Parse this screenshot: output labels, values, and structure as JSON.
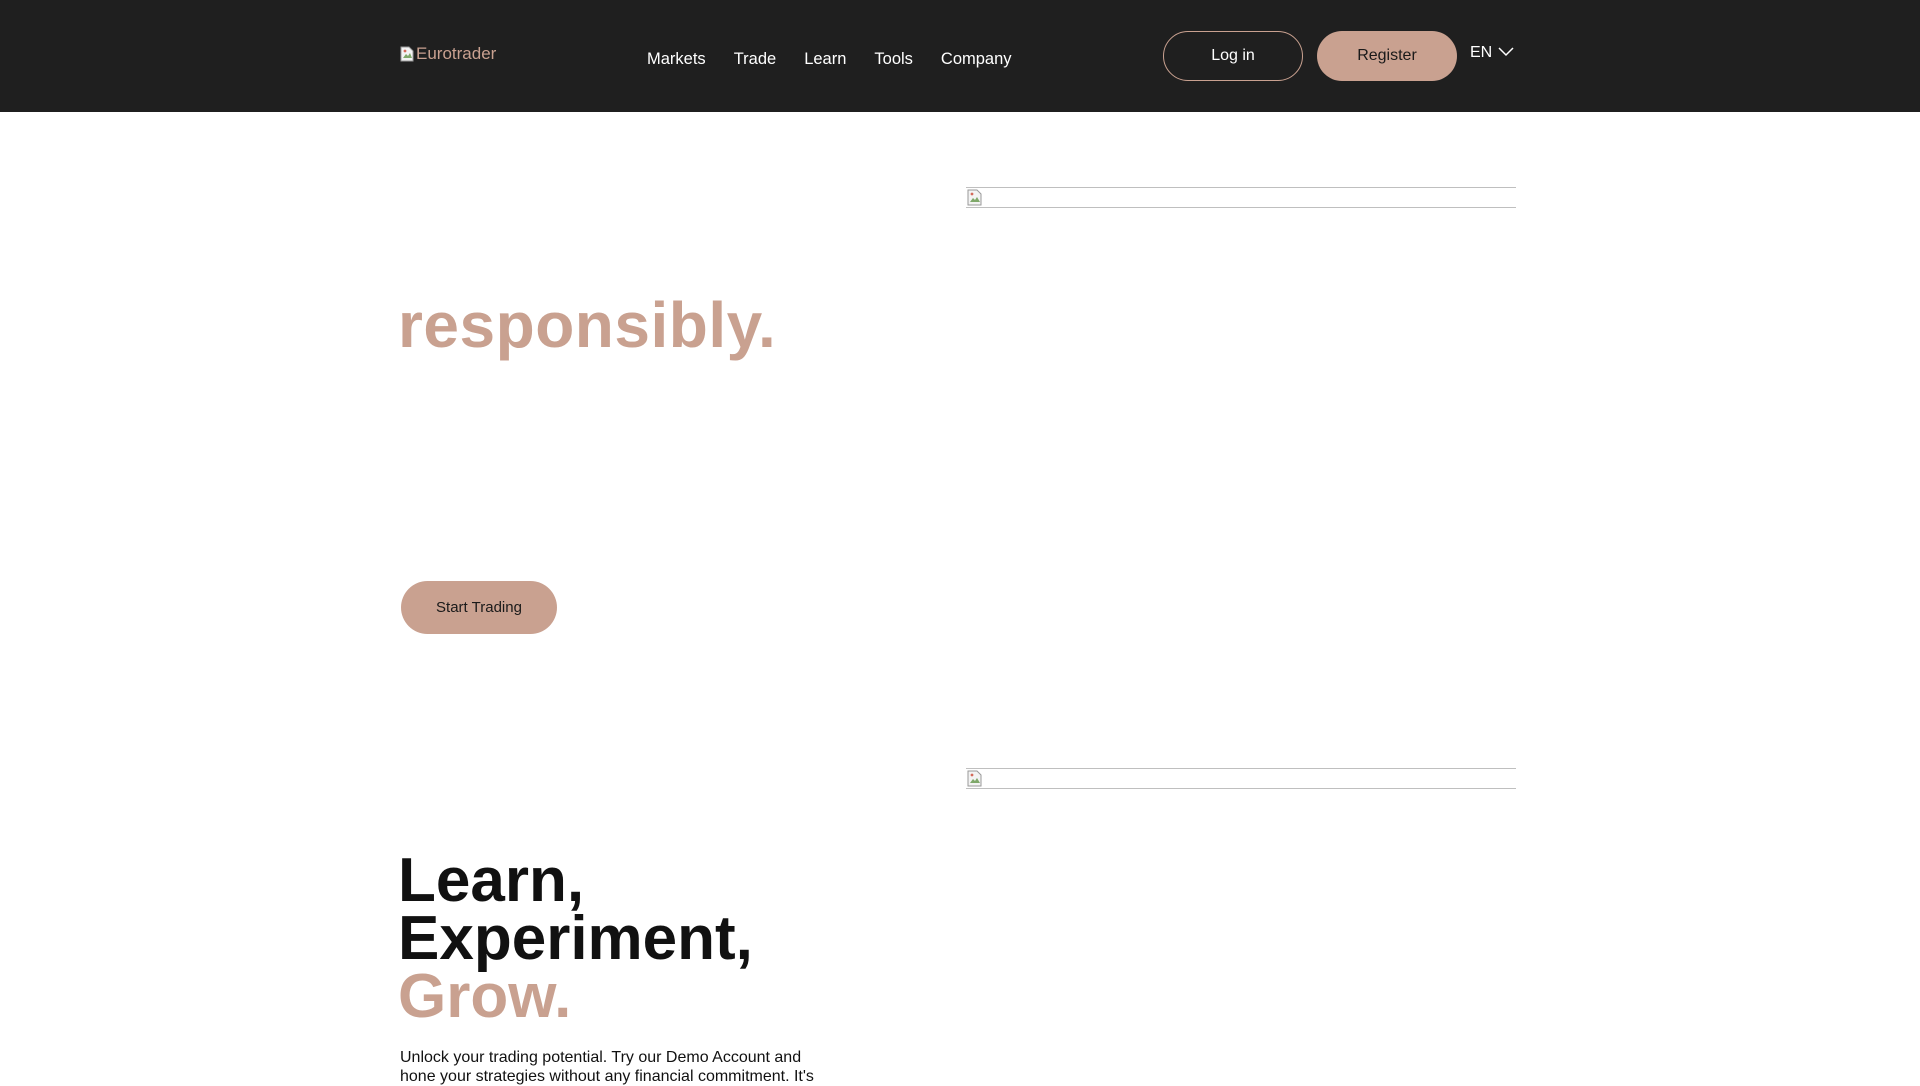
{
  "header": {
    "logo_alt": "Eurotrader",
    "nav": [
      "Markets",
      "Trade",
      "Learn",
      "Tools",
      "Company"
    ],
    "login_label": "Log in",
    "register_label": "Register",
    "language": "EN"
  },
  "hero": {
    "highlight": "responsibly.",
    "cta_label": "Start Trading"
  },
  "section2": {
    "heading_line1": "Learn,",
    "heading_line2": "Experiment,",
    "heading_accent": "Grow.",
    "body": "Unlock your trading potential. Try our Demo Account and hone your strategies without any financial commitment. It's"
  },
  "colors": {
    "header_bg": "#1f1f1f",
    "accent": "#c9a190",
    "text": "#111111"
  }
}
